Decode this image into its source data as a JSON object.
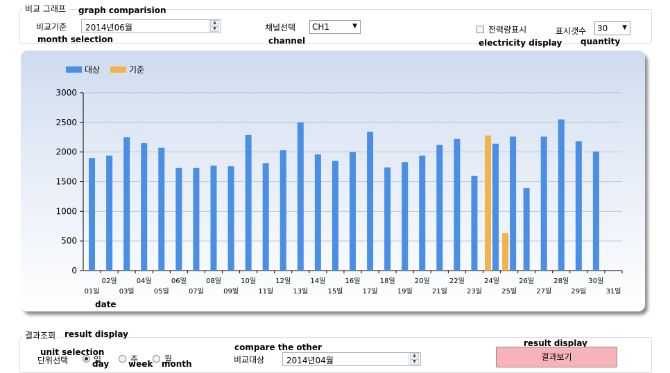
{
  "graph_group": {
    "title": "비교 그래프",
    "title_en": "graph comparision",
    "base_label": "비교기준",
    "base_label_en": "month selection",
    "base_value": "2014년06월",
    "channel_label": "채널선택",
    "channel_label_en": "channel",
    "channel_value": "CH1",
    "power_label": "전력량표시",
    "power_label_en": "electricity display",
    "count_label": "표시갯수",
    "count_label_en": "quantity",
    "count_value": "30"
  },
  "chart_data": {
    "type": "bar",
    "x": [
      "01일",
      "02일",
      "03일",
      "04일",
      "05일",
      "06일",
      "07일",
      "08일",
      "09일",
      "10일",
      "11일",
      "12일",
      "13일",
      "14일",
      "15일",
      "16일",
      "17일",
      "18일",
      "19일",
      "20일",
      "21일",
      "22일",
      "23일",
      "24일",
      "25일",
      "26일",
      "27일",
      "28일",
      "29일",
      "30일",
      "31일"
    ],
    "series": [
      {
        "name": "대상",
        "color": "#4a8fe6",
        "values": [
          1900,
          1940,
          2250,
          2150,
          2070,
          1730,
          1730,
          1770,
          1760,
          2290,
          1810,
          2030,
          2500,
          1960,
          1850,
          2000,
          2340,
          1740,
          1830,
          1940,
          2120,
          2220,
          1600,
          2140,
          2260,
          1390,
          2260,
          2550,
          2180,
          2010,
          null
        ]
      },
      {
        "name": "기준",
        "color": "#f4b24c",
        "values": [
          null,
          null,
          null,
          null,
          null,
          null,
          null,
          null,
          null,
          null,
          null,
          null,
          null,
          null,
          null,
          null,
          null,
          null,
          null,
          null,
          null,
          null,
          null,
          2280,
          630,
          null,
          null,
          null,
          null,
          null,
          null
        ]
      }
    ],
    "ylim": [
      0,
      3000
    ],
    "yticks": [
      0,
      500,
      1000,
      1500,
      2000,
      2500,
      3000
    ],
    "xlabel": "date",
    "legend_position": "top-left",
    "grid": true
  },
  "result_group": {
    "title": "결과조회",
    "title_en": "result display",
    "unit_label": "단위선택",
    "unit_label_en": "unit selection",
    "unit_options": [
      {
        "label": "일",
        "en": "day",
        "selected": true
      },
      {
        "label": "주",
        "en": "week",
        "selected": false
      },
      {
        "label": "월",
        "en": "month",
        "selected": false
      }
    ],
    "compare_label": "비교대상",
    "compare_label_en": "compare the other",
    "compare_value": "2014년04월",
    "result_button": "결과보기",
    "result_button_en": "result display"
  }
}
